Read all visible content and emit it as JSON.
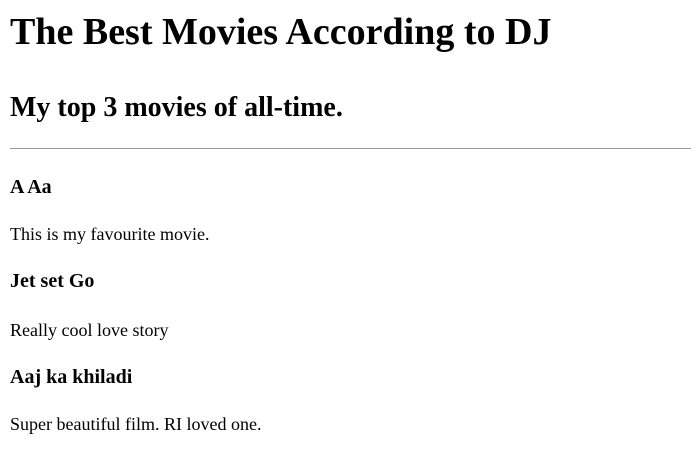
{
  "page": {
    "title": "The Best Movies According to DJ",
    "subtitle": "My top 3 movies of all-time."
  },
  "movies": [
    {
      "title": "A Aa",
      "description": "This is my favourite movie."
    },
    {
      "title": "Jet set Go",
      "description": "Really cool love story"
    },
    {
      "title": "Aaj ka khiladi",
      "description": "Super beautiful film. RI loved one."
    }
  ]
}
